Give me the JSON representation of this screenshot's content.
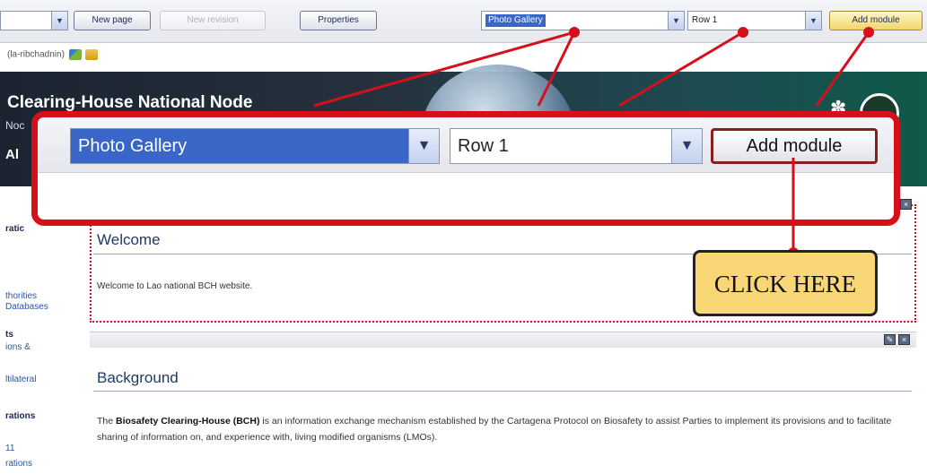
{
  "toolbar": {
    "new_page": "New page",
    "new_revision": "New revision",
    "properties": "Properties",
    "module_select": "Photo Gallery",
    "row_select": "Row 1",
    "add_module": "Add module"
  },
  "user_line": "(la-ribchadnin)",
  "banner": {
    "title": "Clearing-House National Node",
    "sub": "Noc",
    "al": "Al"
  },
  "zoom": {
    "module_select": "Photo Gallery",
    "row_select": "Row 1",
    "add_module": "Add module"
  },
  "callout": {
    "text": "CLICK HERE"
  },
  "sidebar": {
    "h1": "ratic",
    "l1": "thorities",
    "l2": "Databases",
    "h2": "ts",
    "l3": "ions &",
    "l4": "ltilateral",
    "h3": "rations",
    "l5": "11",
    "l6": "rations"
  },
  "welcome": {
    "title": "Welcome",
    "text": "Welcome to Lao national BCH website."
  },
  "background": {
    "title": "Background",
    "text_pre": "The ",
    "text_bold": "Biosafety Clearing-House (BCH)",
    "text_post": " is an information exchange mechanism established by the Cartagena Protocol on Biosafety to assist Parties to implement its provisions and to facilitate sharing of information on, and experience with, living modified organisms (LMOs)."
  },
  "colors": {
    "highlight_red": "#d6101a",
    "callout_yellow": "#f9d776",
    "selected_blue": "#3a66c8"
  }
}
